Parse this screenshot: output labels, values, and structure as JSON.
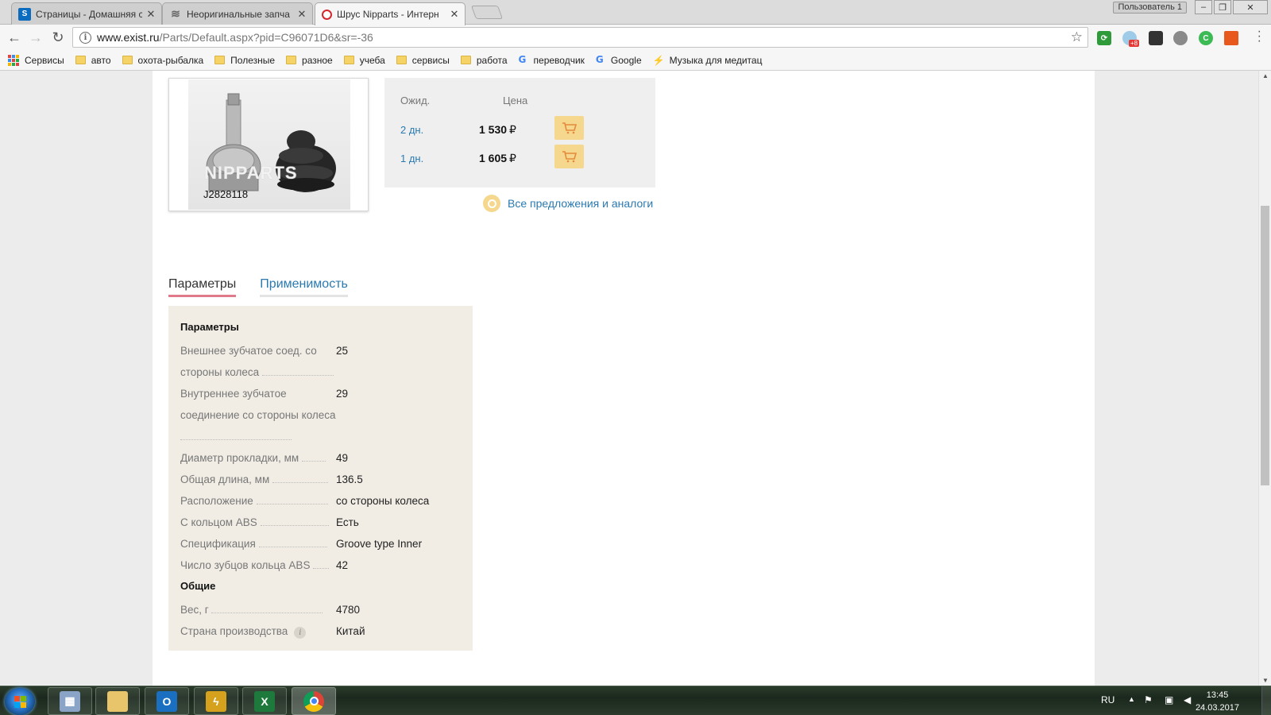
{
  "browser": {
    "tabs": [
      {
        "title": "Страницы - Домашняя с",
        "favicon": "sharepoint-icon",
        "color": "#0b6cbf"
      },
      {
        "title": "Неоригинальные запча",
        "favicon": "lines-icon",
        "color": "#666666"
      },
      {
        "title": "Шрус Nipparts - Интерн",
        "favicon": "exist-icon",
        "color": "#d4262d"
      }
    ],
    "user_button": "Пользователь 1",
    "url_host": "www.exist.ru",
    "url_path": "/Parts/Default.aspx?pid=C96071D6&sr=-36",
    "extension_badge": "+8",
    "bookmarks": [
      {
        "label": "Сервисы",
        "type": "apps"
      },
      {
        "label": "авто",
        "type": "folder"
      },
      {
        "label": "охота-рыбалка",
        "type": "folder"
      },
      {
        "label": "Полезные",
        "type": "folder"
      },
      {
        "label": "разное",
        "type": "folder"
      },
      {
        "label": "учеба",
        "type": "folder"
      },
      {
        "label": "сервисы",
        "type": "folder"
      },
      {
        "label": "работа",
        "type": "folder"
      },
      {
        "label": "переводчик",
        "type": "google"
      },
      {
        "label": "Google",
        "type": "google"
      },
      {
        "label": "Музыка для медитац",
        "type": "music"
      }
    ]
  },
  "product": {
    "image_caption": "J2828118",
    "image_watermark": "NIPPARTS",
    "offers_header": {
      "wait": "Ожид.",
      "price": "Цена"
    },
    "offers": [
      {
        "days": "2 дн.",
        "price": "1 530",
        "currency": "₽"
      },
      {
        "days": "1 дн.",
        "price": "1 605",
        "currency": "₽"
      }
    ],
    "all_offers_link": "Все предложения и аналоги"
  },
  "tabs": {
    "params": "Параметры",
    "applicability": "Применимость"
  },
  "params": {
    "section1_title": "Параметры",
    "section1_rows": [
      {
        "name": "Внешнее зубчатое соед. со стороны колеса",
        "value": "25"
      },
      {
        "name": "Внутреннее зубчатое соединение со стороны колеса",
        "value": "29"
      },
      {
        "name": "Диаметр прокладки, мм",
        "value": "49"
      },
      {
        "name": "Общая длина, мм",
        "value": "136.5"
      },
      {
        "name": "Расположение",
        "value": "со стороны колеса"
      },
      {
        "name": "С кольцом ABS",
        "value": "Есть"
      },
      {
        "name": "Спецификация",
        "value": "Groove type Inner"
      },
      {
        "name": "Число зубцов кольца ABS",
        "value": "42"
      }
    ],
    "section2_title": "Общие",
    "section2_rows": [
      {
        "name": "Вес, г",
        "value": "4780"
      },
      {
        "name": "Страна производства",
        "value": "Китай",
        "info": true
      }
    ]
  },
  "taskbar": {
    "apps": [
      "calculator-icon",
      "explorer-icon",
      "outlook-icon",
      "winamp-icon",
      "excel-icon",
      "chrome-icon"
    ],
    "lang": "RU",
    "time": "13:45",
    "date": "24.03.2017"
  },
  "colors": {
    "link": "#2a7ab0",
    "accent_tab": "#e07a8a",
    "cart": "#f5d88e",
    "params_bg": "#f1ede5"
  }
}
